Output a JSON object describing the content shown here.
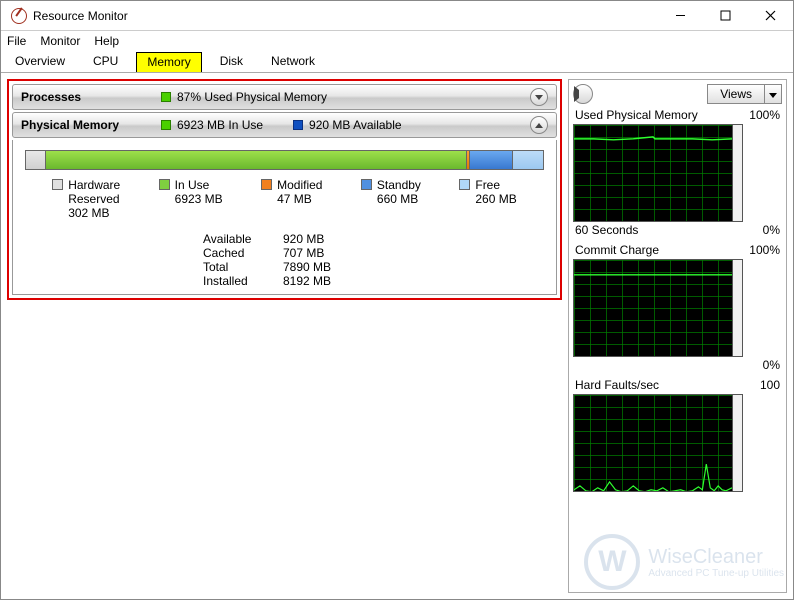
{
  "window": {
    "title": "Resource Monitor"
  },
  "menu": {
    "file": "File",
    "monitor": "Monitor",
    "help": "Help"
  },
  "tabs": {
    "overview": "Overview",
    "cpu": "CPU",
    "memory": "Memory",
    "disk": "Disk",
    "network": "Network"
  },
  "processes": {
    "label": "Processes",
    "usage_text": "87% Used Physical Memory"
  },
  "physical": {
    "label": "Physical Memory",
    "in_use_text": "6923 MB In Use",
    "available_text": "920 MB Available",
    "legend": {
      "hw": {
        "name": "Hardware",
        "name2": "Reserved",
        "val": "302 MB"
      },
      "use": {
        "name": "In Use",
        "val": "6923 MB"
      },
      "mod": {
        "name": "Modified",
        "val": "47 MB"
      },
      "sby": {
        "name": "Standby",
        "val": "660 MB"
      },
      "free": {
        "name": "Free",
        "val": "260 MB"
      }
    },
    "totals": {
      "available_k": "Available",
      "available_v": "920 MB",
      "cached_k": "Cached",
      "cached_v": "707 MB",
      "total_k": "Total",
      "total_v": "7890 MB",
      "installed_k": "Installed",
      "installed_v": "8192 MB"
    }
  },
  "sidebar": {
    "views": "Views",
    "g1": {
      "title": "Used Physical Memory",
      "max": "100%",
      "bottom_left": "60 Seconds",
      "bottom_right": "0%"
    },
    "g2": {
      "title": "Commit Charge",
      "max": "100%",
      "bottom_right": "0%"
    },
    "g3": {
      "title": "Hard Faults/sec",
      "max": "100"
    }
  },
  "watermark": {
    "letter": "W",
    "line1": "WiseCleaner",
    "line2": "Advanced PC Tune-up Utilities"
  },
  "chart_data": [
    {
      "type": "line",
      "title": "Used Physical Memory",
      "ylim": [
        0,
        100
      ],
      "ylabel": "%",
      "xlabel": "60 Seconds",
      "series": [
        {
          "name": "Used",
          "values": [
            87,
            87,
            86,
            87,
            88,
            87,
            87,
            87,
            86,
            87,
            87,
            87
          ]
        }
      ]
    },
    {
      "type": "line",
      "title": "Commit Charge",
      "ylim": [
        0,
        100
      ],
      "ylabel": "%",
      "series": [
        {
          "name": "Commit",
          "values": [
            86,
            86,
            86,
            86,
            86,
            86,
            86,
            86,
            86,
            86,
            86,
            86
          ]
        }
      ]
    },
    {
      "type": "line",
      "title": "Hard Faults/sec",
      "ylim": [
        0,
        100
      ],
      "series": [
        {
          "name": "Faults",
          "values": [
            2,
            4,
            1,
            0,
            3,
            1,
            8,
            2,
            0,
            1,
            5,
            1,
            0,
            2,
            1,
            3,
            0,
            1,
            2,
            0,
            1,
            4,
            2,
            28,
            3,
            1,
            5,
            2,
            1,
            3
          ]
        }
      ]
    }
  ]
}
